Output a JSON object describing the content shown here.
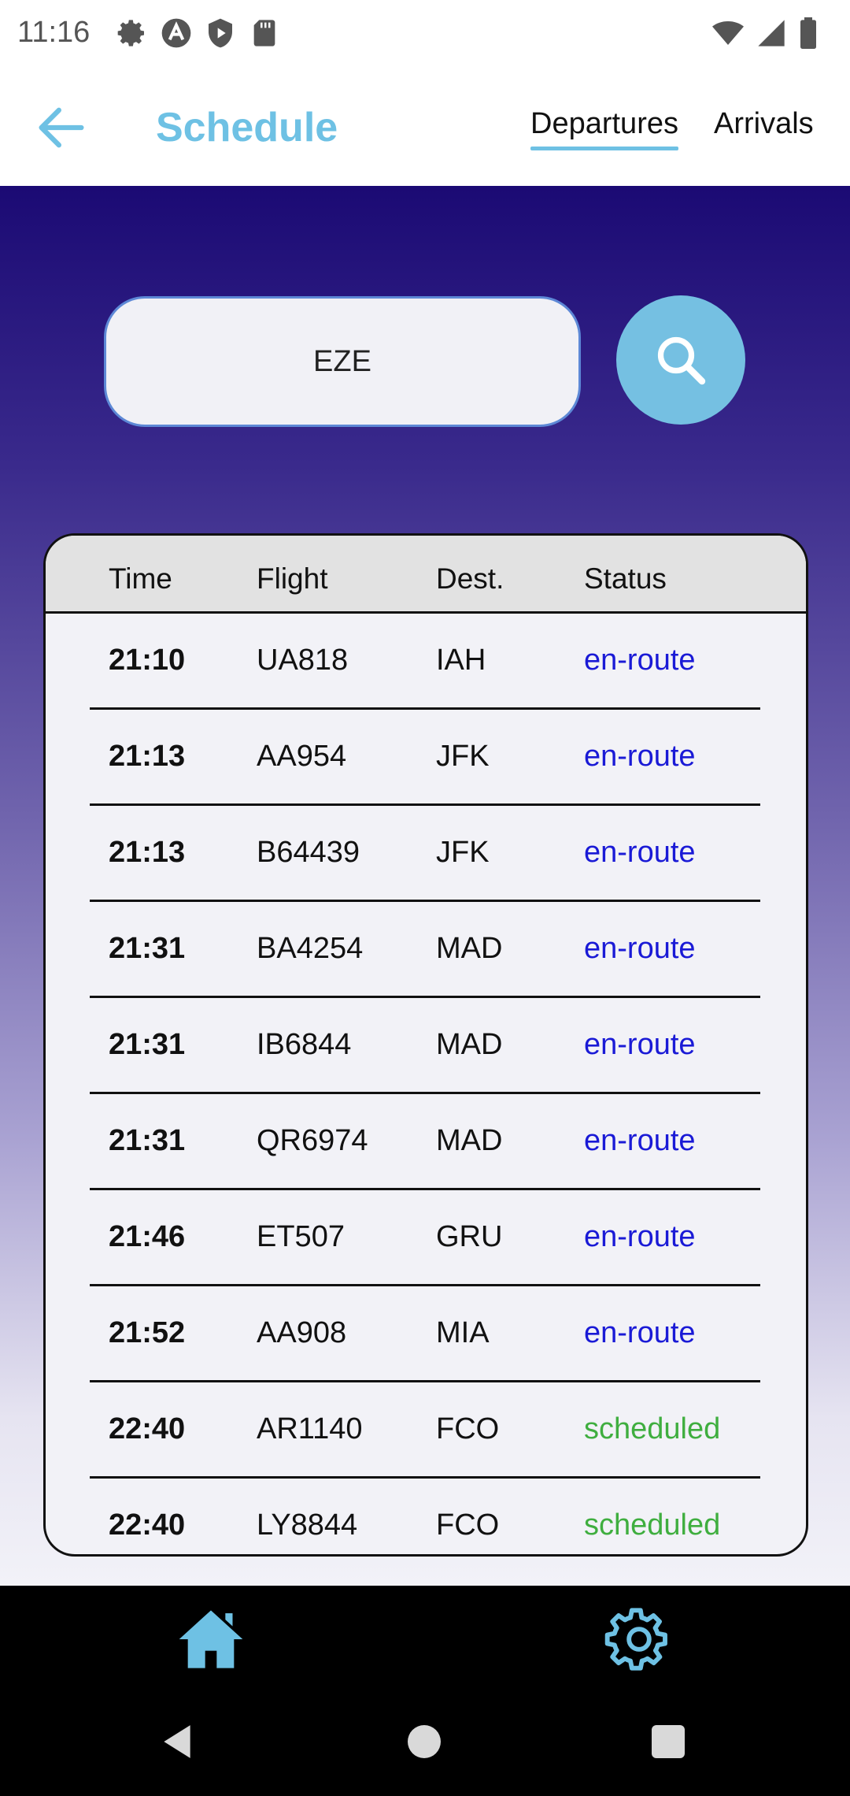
{
  "status_bar": {
    "time": "11:16",
    "left_icons": [
      "settings-icon",
      "a-icon",
      "shield-play-icon",
      "sd-card-icon"
    ],
    "right_icons": [
      "wifi-icon",
      "signal-icon",
      "battery-icon"
    ]
  },
  "app_bar": {
    "title": "Schedule",
    "tabs": [
      {
        "label": "Departures",
        "selected": true
      },
      {
        "label": "Arrivals",
        "selected": false
      }
    ],
    "accent_color": "#6ec1e4"
  },
  "search": {
    "value": "EZE"
  },
  "table": {
    "headers": [
      "Time",
      "Flight",
      "Dest.",
      "Status"
    ],
    "rows": [
      {
        "time": "21:10",
        "flight": "UA818",
        "dest": "IAH",
        "status": "en-route"
      },
      {
        "time": "21:13",
        "flight": "AA954",
        "dest": "JFK",
        "status": "en-route"
      },
      {
        "time": "21:13",
        "flight": "B64439",
        "dest": "JFK",
        "status": "en-route"
      },
      {
        "time": "21:31",
        "flight": "BA4254",
        "dest": "MAD",
        "status": "en-route"
      },
      {
        "time": "21:31",
        "flight": "IB6844",
        "dest": "MAD",
        "status": "en-route"
      },
      {
        "time": "21:31",
        "flight": "QR6974",
        "dest": "MAD",
        "status": "en-route"
      },
      {
        "time": "21:46",
        "flight": "ET507",
        "dest": "GRU",
        "status": "en-route"
      },
      {
        "time": "21:52",
        "flight": "AA908",
        "dest": "MIA",
        "status": "en-route"
      },
      {
        "time": "22:40",
        "flight": "AR1140",
        "dest": "FCO",
        "status": "scheduled"
      },
      {
        "time": "22:40",
        "flight": "LY8844",
        "dest": "FCO",
        "status": "scheduled"
      }
    ],
    "status_colors": {
      "en-route": "#1a1ad6",
      "scheduled": "#3fae3f"
    }
  },
  "bottom_nav": {
    "items": [
      "home-icon",
      "settings-icon"
    ]
  },
  "system_nav": [
    "back-icon",
    "home-circle-icon",
    "recents-square-icon"
  ]
}
